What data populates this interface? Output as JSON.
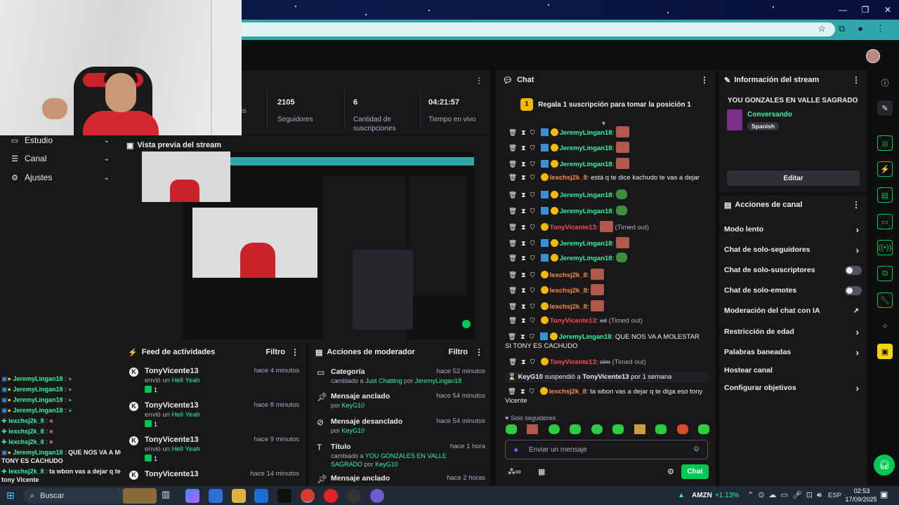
{
  "stats": {
    "items": [
      {
        "value": "",
        "label": "es"
      },
      {
        "value": "2105",
        "label": "Seguidores"
      },
      {
        "value": "6",
        "label": "Cantidad de suscripciones"
      },
      {
        "value": "04:21:57",
        "label": "Tiempo en vivo"
      }
    ]
  },
  "nav": {
    "items": [
      {
        "label": "Estudio"
      },
      {
        "label": "Canal"
      },
      {
        "label": "Ajustes"
      }
    ]
  },
  "preview": {
    "title": "Vista previa del stream"
  },
  "left_chat": [
    {
      "user": "JeremyLingan18",
      "msg": ""
    },
    {
      "user": "JeremyLingan18",
      "msg": ""
    },
    {
      "user": "JeremyLingan18",
      "msg": ""
    },
    {
      "user": "JeremyLingan18",
      "msg": ""
    },
    {
      "user": "lexchsj2k_8",
      "msg": ""
    },
    {
      "user": "lexchsj2k_8",
      "msg": ""
    },
    {
      "user": "lexchsj2k_8",
      "msg": ""
    },
    {
      "user": "JeremyLingan18",
      "msg": "QUE NOS VA A MOLESTAR SI TONY ES CACHUDO"
    },
    {
      "user": "lexchsj2k_8",
      "msg": "ta wbon vas a dejar q te diga eso tony Vicente"
    }
  ],
  "feed": {
    "title": "Feed de actividades",
    "filter": "Filtro",
    "items": [
      {
        "name": "TonyVicente13",
        "time": "hace 4 minutos",
        "action": "envió un",
        "item": "Hell Yeah",
        "count": "1"
      },
      {
        "name": "TonyVicente13",
        "time": "hace 8 minutos",
        "action": "envió un",
        "item": "Hell Yeah",
        "count": "1"
      },
      {
        "name": "TonyVicente13",
        "time": "hace 9 minutos",
        "action": "envió un",
        "item": "Hell Yeah",
        "count": "1"
      },
      {
        "name": "TonyVicente13",
        "time": "hace 14 minutos",
        "action": "",
        "item": "",
        "count": ""
      }
    ]
  },
  "modactions": {
    "title": "Acciones de moderador",
    "filter": "Filtro",
    "items": [
      {
        "title": "Categoría",
        "time": "hace 52 minutos",
        "pre": "cambiado a",
        "target": "Just Chatting",
        "mid": "por",
        "by": "JeremyLingan18"
      },
      {
        "title": "Mensaje anclado",
        "time": "hace 54 minutos",
        "pre": "",
        "target": "",
        "mid": "por",
        "by": "KeyG10"
      },
      {
        "title": "Mensaje desanclado",
        "time": "hace 54 minutos",
        "pre": "",
        "target": "",
        "mid": "por",
        "by": "KeyG10"
      },
      {
        "title": "Título",
        "time": "hace 1 hora",
        "pre": "cambiado a",
        "target": "YOU GONZALES EN VALLE SAGRADO",
        "mid": "por",
        "by": "KeyG10"
      },
      {
        "title": "Mensaje anclado",
        "time": "hace 2 horas",
        "pre": "",
        "target": "",
        "mid": "",
        "by": ""
      }
    ]
  },
  "chat": {
    "title": "Chat",
    "pinned": "Regala 1 suscripción para tomar la posición 1",
    "pinned_rank": "1",
    "messages": [
      {
        "user": "JeremyLingan18",
        "color": "green",
        "text": "",
        "note": ""
      },
      {
        "user": "JeremyLingan18",
        "color": "green",
        "text": "",
        "note": ""
      },
      {
        "user": "JeremyLingan18",
        "color": "green",
        "text": "",
        "note": ""
      },
      {
        "user": "lexchsj2k_8",
        "color": "orange",
        "text": "está q te dice kachudo te vas a dejar",
        "note": ""
      },
      {
        "user": "JeremyLingan18",
        "color": "green",
        "text": "",
        "note": ""
      },
      {
        "user": "JeremyLingan18",
        "color": "green",
        "text": "",
        "note": ""
      },
      {
        "user": "TonyVicente13",
        "color": "red",
        "text": "",
        "note": "(Timed out)"
      },
      {
        "user": "JeremyLingan18",
        "color": "green",
        "text": "",
        "note": ""
      },
      {
        "user": "JeremyLingan18",
        "color": "green",
        "text": "",
        "note": ""
      },
      {
        "user": "lexchsj2k_8",
        "color": "orange",
        "text": "",
        "note": ""
      },
      {
        "user": "lexchsj2k_8",
        "color": "orange",
        "text": "",
        "note": ""
      },
      {
        "user": "lexchsj2k_8",
        "color": "orange",
        "text": "",
        "note": ""
      },
      {
        "user": "TonyVicente13",
        "color": "red",
        "text": "xd",
        "note": "(Timed out)"
      },
      {
        "user": "JeremyLingan18",
        "color": "green",
        "text": "QUE NOS VA A MOLESTAR SI TONY ES CACHUDO",
        "note": ""
      },
      {
        "user": "TonyVicente13",
        "color": "red",
        "text": "clm",
        "note": "(Timed out)"
      }
    ],
    "suspend": {
      "mod": "KeyG10",
      "verb": "suspendió a",
      "target": "TonyVicente13",
      "duration": "por 1 semana"
    },
    "last": {
      "user": "lexchsj2k_8",
      "text": "ta wbon vas a dejar q te diga eso tony Vicente"
    },
    "mode": "Solo seguidores",
    "input_placeholder": "Enviar un mensaje",
    "send_label": "Chat"
  },
  "info": {
    "title": "Información del stream",
    "stream_title": "YOU GONZALES EN VALLE SAGRADO",
    "category": "Conversando",
    "language": "Spanish",
    "edit_label": "Editar"
  },
  "channel_actions": {
    "title": "Acciones de canal",
    "items": [
      {
        "label": "Modo lento",
        "kind": "chevron"
      },
      {
        "label": "Chat de solo-seguidores",
        "kind": "chevron"
      },
      {
        "label": "Chat de solo-suscriptores",
        "kind": "toggle"
      },
      {
        "label": "Chat de solo-emotes",
        "kind": "toggle"
      },
      {
        "label": "Moderación del chat con IA",
        "kind": "external"
      },
      {
        "label": "Restricción de edad",
        "kind": "chevron"
      },
      {
        "label": "Palabras baneadas",
        "kind": "chevron"
      },
      {
        "label": "Hostear canal",
        "kind": "none"
      },
      {
        "label": "Configurar objetivos",
        "kind": "chevron"
      }
    ]
  },
  "taskbar": {
    "search_placeholder": "Buscar",
    "ticker": "AMZN",
    "change": "+1.13%",
    "lang": "ESP",
    "time": "02:53",
    "date": "17/09/2025"
  },
  "colors": {
    "accent": "#00c853",
    "green_user": "#2ef59e",
    "bg": "#18181b"
  }
}
